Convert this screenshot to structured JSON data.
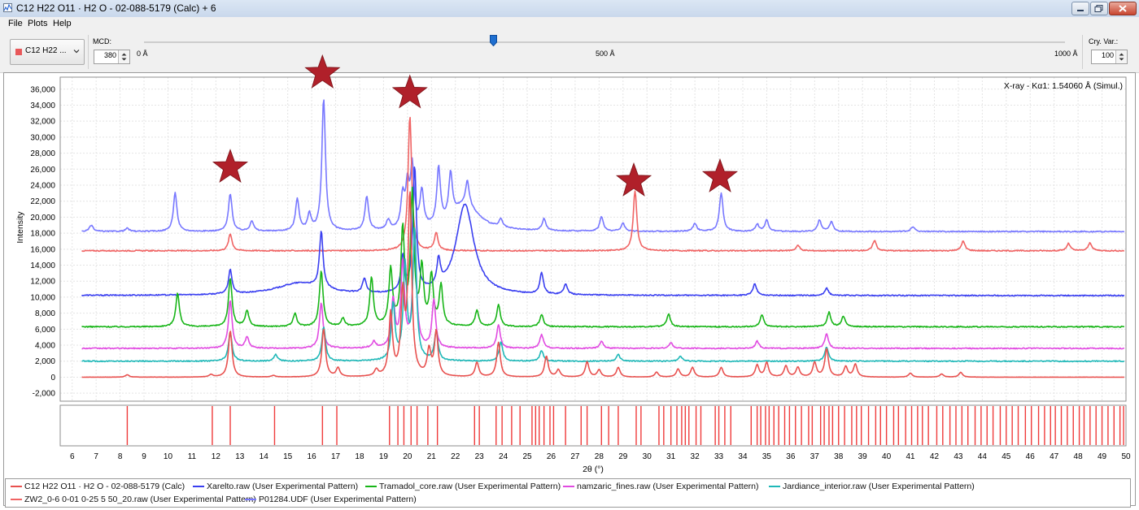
{
  "window": {
    "title": "C12 H22 O11 · H2 O - 02-088-5179 (Calc) + 6"
  },
  "menu": [
    "File",
    "Plots",
    "Help"
  ],
  "toolbar": {
    "phase_select": "C12 H22 ...",
    "mcd_label": "MCD:",
    "mcd_value": "380",
    "slider_ticks": [
      "0 Å",
      "500 Å",
      "1000 Å"
    ],
    "cry_var_label": "Cry. Var.:",
    "cry_var_value": "100"
  },
  "chart_data": {
    "type": "line",
    "radiation_label": "X-ray - Kα1: 1.54060 Å (Simul.)",
    "xlabel": "2θ (°)",
    "ylabel": "Intensity",
    "xlim": [
      5.5,
      50
    ],
    "ylim": [
      -3000,
      37500
    ],
    "x_ticks": [
      6,
      7,
      8,
      9,
      10,
      11,
      12,
      13,
      14,
      15,
      16,
      17,
      18,
      19,
      20,
      21,
      22,
      23,
      24,
      25,
      26,
      27,
      28,
      29,
      30,
      31,
      32,
      33,
      34,
      35,
      36,
      37,
      38,
      39,
      40,
      41,
      42,
      43,
      44,
      45,
      46,
      47,
      48,
      49,
      50
    ],
    "y_ticks": [
      -2000,
      0,
      2000,
      4000,
      6000,
      8000,
      10000,
      12000,
      14000,
      16000,
      18000,
      20000,
      22000,
      24000,
      26000,
      28000,
      30000,
      32000,
      34000,
      36000
    ],
    "y_tick_labels": [
      "-2,000",
      "0",
      "2,000",
      "4,000",
      "6,000",
      "8,000",
      "10,000",
      "12,000",
      "14,000",
      "16,000",
      "18,000",
      "20,000",
      "22,000",
      "24,000",
      "26,000",
      "28,000",
      "30,000",
      "32,000",
      "34,000",
      "36,000"
    ],
    "grid": true,
    "legend_position": "bottom",
    "series": [
      {
        "name": "C12 H22 O11 · H2 O - 02-088-5179 (Calc)",
        "color": "#e8514f",
        "base": 0,
        "broad": [],
        "peaks": [
          [
            8.3,
            300
          ],
          [
            11.8,
            300
          ],
          [
            12.6,
            5800
          ],
          [
            14.4,
            200
          ],
          [
            16.5,
            6000
          ],
          [
            17.1,
            1100
          ],
          [
            18.7,
            800
          ],
          [
            19.3,
            7800
          ],
          [
            19.8,
            9700
          ],
          [
            20.1,
            22500
          ],
          [
            20.9,
            3200
          ],
          [
            21.2,
            5500
          ],
          [
            22.9,
            1800
          ],
          [
            23.8,
            4300
          ],
          [
            25.8,
            2600
          ],
          [
            26.3,
            900
          ],
          [
            27.5,
            1900
          ],
          [
            28.0,
            900
          ],
          [
            28.8,
            1200
          ],
          [
            30.4,
            600
          ],
          [
            31.3,
            1000
          ],
          [
            31.9,
            1200
          ],
          [
            33.1,
            1200
          ],
          [
            34.6,
            1500
          ],
          [
            35.0,
            1800
          ],
          [
            35.8,
            1400
          ],
          [
            36.3,
            1200
          ],
          [
            37.0,
            1800
          ],
          [
            37.5,
            3500
          ],
          [
            38.3,
            1300
          ],
          [
            38.7,
            1600
          ],
          [
            41.0,
            500
          ],
          [
            42.3,
            400
          ],
          [
            43.1,
            600
          ]
        ]
      },
      {
        "name": "Xarelto.raw (User Experimental Pattern)",
        "color": "#3a3ff0",
        "base": 10200,
        "broad": [
          [
            22.4,
            11300,
            0.45
          ],
          [
            15.5,
            1500,
            1.2
          ]
        ],
        "peaks": [
          [
            12.6,
            3000
          ],
          [
            16.4,
            7000
          ],
          [
            18.2,
            1800
          ],
          [
            19.8,
            4400
          ],
          [
            20.3,
            15500
          ],
          [
            21.3,
            3200
          ],
          [
            25.6,
            2600
          ],
          [
            26.6,
            1300
          ],
          [
            34.5,
            1500
          ],
          [
            37.5,
            900
          ]
        ]
      },
      {
        "name": "Tramadol_core.raw (User Experimental Pattern)",
        "color": "#18b518",
        "base": 6300,
        "broad": [],
        "peaks": [
          [
            10.4,
            4200
          ],
          [
            12.6,
            6000
          ],
          [
            13.3,
            2000
          ],
          [
            15.3,
            1600
          ],
          [
            16.4,
            7000
          ],
          [
            17.3,
            1000
          ],
          [
            18.5,
            6000
          ],
          [
            19.3,
            7000
          ],
          [
            19.8,
            11900
          ],
          [
            20.2,
            16300
          ],
          [
            20.6,
            7000
          ],
          [
            21.0,
            6200
          ],
          [
            21.4,
            5000
          ],
          [
            22.9,
            2000
          ],
          [
            23.8,
            2700
          ],
          [
            25.6,
            1500
          ],
          [
            30.9,
            1600
          ],
          [
            34.8,
            1500
          ],
          [
            37.6,
            1800
          ],
          [
            38.2,
            1300
          ]
        ]
      },
      {
        "name": "namzaric_fines.raw (User Experimental Pattern)",
        "color": "#e14be1",
        "base": 3600,
        "broad": [],
        "peaks": [
          [
            12.6,
            6000
          ],
          [
            13.3,
            1400
          ],
          [
            16.4,
            5700
          ],
          [
            18.6,
            800
          ],
          [
            19.4,
            5900
          ],
          [
            19.8,
            10600
          ],
          [
            20.3,
            14500
          ],
          [
            21.1,
            6000
          ],
          [
            23.8,
            2900
          ],
          [
            25.6,
            1700
          ],
          [
            28.1,
            900
          ],
          [
            31.0,
            700
          ],
          [
            34.6,
            900
          ],
          [
            37.5,
            1800
          ]
        ]
      },
      {
        "name": "Jardiance_interior.raw (User Experimental Pattern)",
        "color": "#1fb8b8",
        "base": 2000,
        "broad": [],
        "peaks": [
          [
            12.6,
            3600
          ],
          [
            14.5,
            800
          ],
          [
            16.5,
            4300
          ],
          [
            19.4,
            7000
          ],
          [
            19.9,
            11700
          ],
          [
            20.3,
            16200
          ],
          [
            21.2,
            3600
          ],
          [
            23.9,
            2400
          ],
          [
            25.6,
            1300
          ],
          [
            28.8,
            800
          ],
          [
            31.4,
            600
          ],
          [
            37.5,
            1800
          ]
        ]
      },
      {
        "name": "ZW2_0-6 0-01 0-25 5 50_20.raw (User Experimental Pattern)",
        "color": "#f06464",
        "base": 15800,
        "broad": [],
        "peaks": [
          [
            12.6,
            2100
          ],
          [
            20.1,
            16800
          ],
          [
            21.2,
            2200
          ],
          [
            29.5,
            7500
          ],
          [
            36.3,
            700
          ],
          [
            39.5,
            1300
          ],
          [
            43.2,
            1200
          ],
          [
            47.6,
            900
          ],
          [
            48.5,
            1000
          ]
        ]
      },
      {
        "name": "P01284.UDF (User Experimental Pattern)",
        "color": "#7878ff",
        "base": 18200,
        "broad": [
          [
            22.4,
            3300,
            0.7
          ]
        ],
        "peaks": [
          [
            6.8,
            800
          ],
          [
            8.3,
            400
          ],
          [
            10.3,
            4800
          ],
          [
            12.6,
            4700
          ],
          [
            13.5,
            1300
          ],
          [
            15.4,
            4000
          ],
          [
            15.9,
            2000
          ],
          [
            16.5,
            16500
          ],
          [
            18.3,
            4200
          ],
          [
            19.2,
            1200
          ],
          [
            19.8,
            4000
          ],
          [
            20.0,
            5000
          ],
          [
            20.2,
            7500
          ],
          [
            20.6,
            4500
          ],
          [
            21.3,
            7000
          ],
          [
            21.8,
            5500
          ],
          [
            22.5,
            3000
          ],
          [
            23.9,
            1000
          ],
          [
            25.7,
            1500
          ],
          [
            28.1,
            1800
          ],
          [
            29.0,
            1000
          ],
          [
            32.0,
            1000
          ],
          [
            33.1,
            4800
          ],
          [
            34.6,
            900
          ],
          [
            35.0,
            1400
          ],
          [
            37.2,
            1400
          ],
          [
            37.7,
            1200
          ],
          [
            41.1,
            600
          ]
        ]
      }
    ],
    "reference_ticks": [
      8.3,
      11.85,
      12.6,
      14.45,
      16.45,
      17.05,
      19.25,
      19.6,
      19.85,
      20.15,
      20.4,
      20.85,
      21.25,
      22.8,
      23.0,
      23.7,
      23.95,
      24.35,
      24.7,
      25.2,
      25.35,
      25.5,
      25.7,
      25.95,
      26.1,
      26.6,
      27.25,
      27.5,
      28.1,
      28.4,
      28.8,
      29.55,
      29.75,
      30.5,
      30.7,
      31.0,
      31.25,
      31.45,
      31.6,
      31.75,
      32.05,
      32.25,
      32.85,
      33.0,
      33.25,
      33.5,
      34.35,
      34.6,
      34.75,
      34.95,
      35.1,
      35.3,
      35.5,
      35.75,
      35.95,
      36.2,
      36.45,
      36.75,
      36.9,
      37.25,
      37.4,
      37.6,
      37.75,
      38.0,
      38.25,
      38.55,
      38.75,
      38.95,
      39.25,
      39.55,
      39.75,
      40.0,
      40.3,
      40.5,
      40.8,
      41.05,
      41.3,
      41.5,
      41.75,
      42.1,
      42.35,
      42.65,
      42.9,
      43.15,
      43.4,
      43.7,
      43.95,
      44.2,
      44.45,
      44.75,
      45.0,
      45.25,
      45.5,
      45.8,
      46.05,
      46.35,
      46.6,
      46.85,
      47.05,
      47.3,
      47.55,
      47.8,
      48.05,
      48.25,
      48.5,
      48.75,
      49.0,
      49.25,
      49.5,
      49.75,
      49.9
    ],
    "star_annotations": [
      {
        "x": 12.6,
        "y": 26200
      },
      {
        "x": 16.45,
        "y": 38000
      },
      {
        "x": 20.1,
        "y": 35500
      },
      {
        "x": 29.45,
        "y": 24500
      },
      {
        "x": 33.05,
        "y": 25000
      }
    ]
  },
  "colors": {
    "star": "#b0202a",
    "reference_tick": "#ef3b3b"
  }
}
